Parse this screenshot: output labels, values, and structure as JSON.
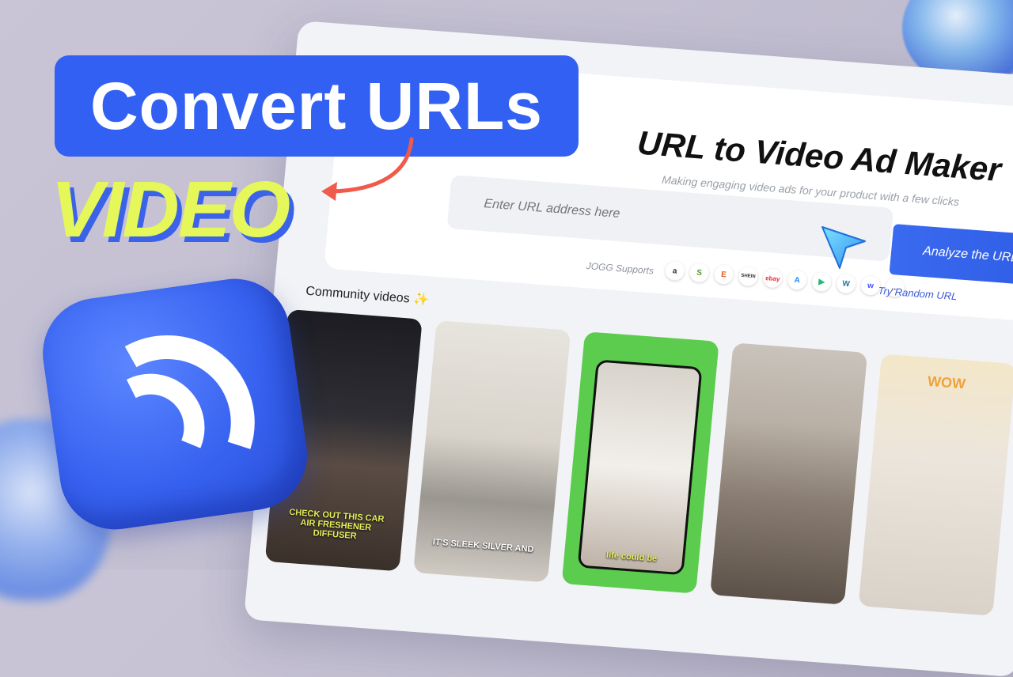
{
  "headline": {
    "pill_text": "Convert URLs",
    "video_word": "VIDEO"
  },
  "app": {
    "title": "URL to Video Ad Maker",
    "subtitle": "Making engaging video ads for your product with a few clicks",
    "url_placeholder": "Enter URL address here",
    "analyze_label": "Analyze the URL",
    "supports_label": "JOGG Supports",
    "try_random_label": "Try Random URL",
    "community_label": "Community videos ✨",
    "brands": [
      "a",
      "S",
      "E",
      "SHEIN",
      "ebay",
      "A",
      "▶",
      "W",
      "w",
      "..."
    ],
    "videos": [
      {
        "caption": "CHECK OUT THIS CAR AIR FRESHENER DIFFUSER"
      },
      {
        "caption": "IT'S SLEEK SILVER AND"
      },
      {
        "caption": "life could be"
      },
      {
        "caption": ""
      },
      {
        "caption": "WOW"
      }
    ]
  },
  "colors": {
    "accent": "#3260f2",
    "video_yellow": "#e6f75a",
    "arrow": "#ef5a4a"
  }
}
